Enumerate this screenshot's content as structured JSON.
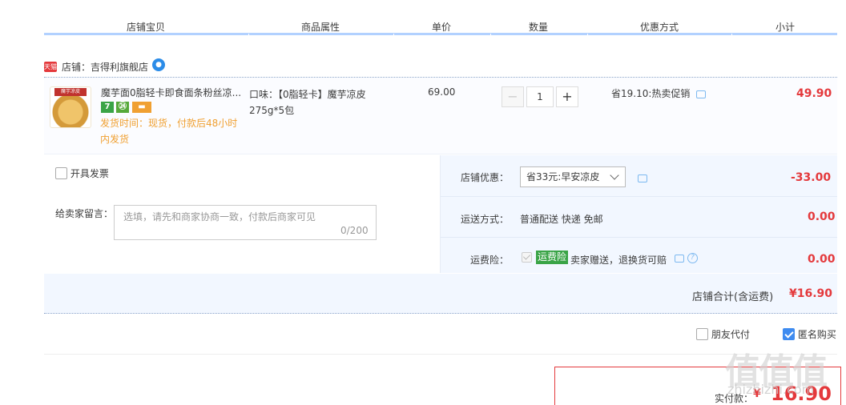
{
  "columns": [
    "店铺宝贝",
    "商品属性",
    "单价",
    "数量",
    "优惠方式",
    "小计"
  ],
  "shop": {
    "badge": "天猫",
    "label": "店铺：吉得利旗舰店",
    "ww_icon": "chat-bubble-icon"
  },
  "item": {
    "image_tag": "魔芋凉皮",
    "title": "魔芋面0脂轻卡即食面条粉丝凉...",
    "service_icons": [
      {
        "text": "7",
        "color": "#3aa447"
      },
      {
        "text": "㉔",
        "color": "#56a93a"
      },
      {
        "text": "▬",
        "color": "#f0a032"
      }
    ],
    "delivery": "发货时间：现货，付款后48小时内发货",
    "attribute": "口味：【0脂轻卡】魔芋凉皮275g*5包",
    "unit_price": "69.00",
    "quantity": "1",
    "minus_label": "−",
    "plus_label": "+",
    "promo": "省19.10:热卖促销",
    "subtotal": "49.90"
  },
  "order": {
    "invoice_label": "开具发票",
    "message_label": "给卖家留言：",
    "message_placeholder": "选填，请先和商家协商一致，付款后商家可见",
    "message_count": "0/200",
    "shop_discount_label": "店铺优惠：",
    "shop_discount_option": "省33元:早安凉皮",
    "shop_discount_value": "-33.00",
    "shipping_label": "运送方式：",
    "shipping_option": "普通配送 快递 免邮",
    "shipping_value": "0.00",
    "insurance_label": "运费险：",
    "insurance_badge": "运费险",
    "insurance_text": "卖家赠送，退换货可赔",
    "insurance_value": "0.00",
    "help_glyph": "?",
    "shop_total_label": "店铺合计(含运费)",
    "shop_total_value": "¥16.90"
  },
  "options": {
    "friend_pay": "朋友代付",
    "anonymous": "匿名购买",
    "anonymous_checked": true
  },
  "payment": {
    "label": "实付款：",
    "currency": "¥",
    "amount": "16.90"
  },
  "watermark": {
    "text": "值值值",
    "url": "zhizhizhi.com"
  },
  "colors": {
    "accent_red": "#e4393c",
    "header_line": "#b2d1ff",
    "panel_bg": "#f2f7ff",
    "check_blue": "#3e8bf0",
    "insurance_green": "#3aa447"
  }
}
